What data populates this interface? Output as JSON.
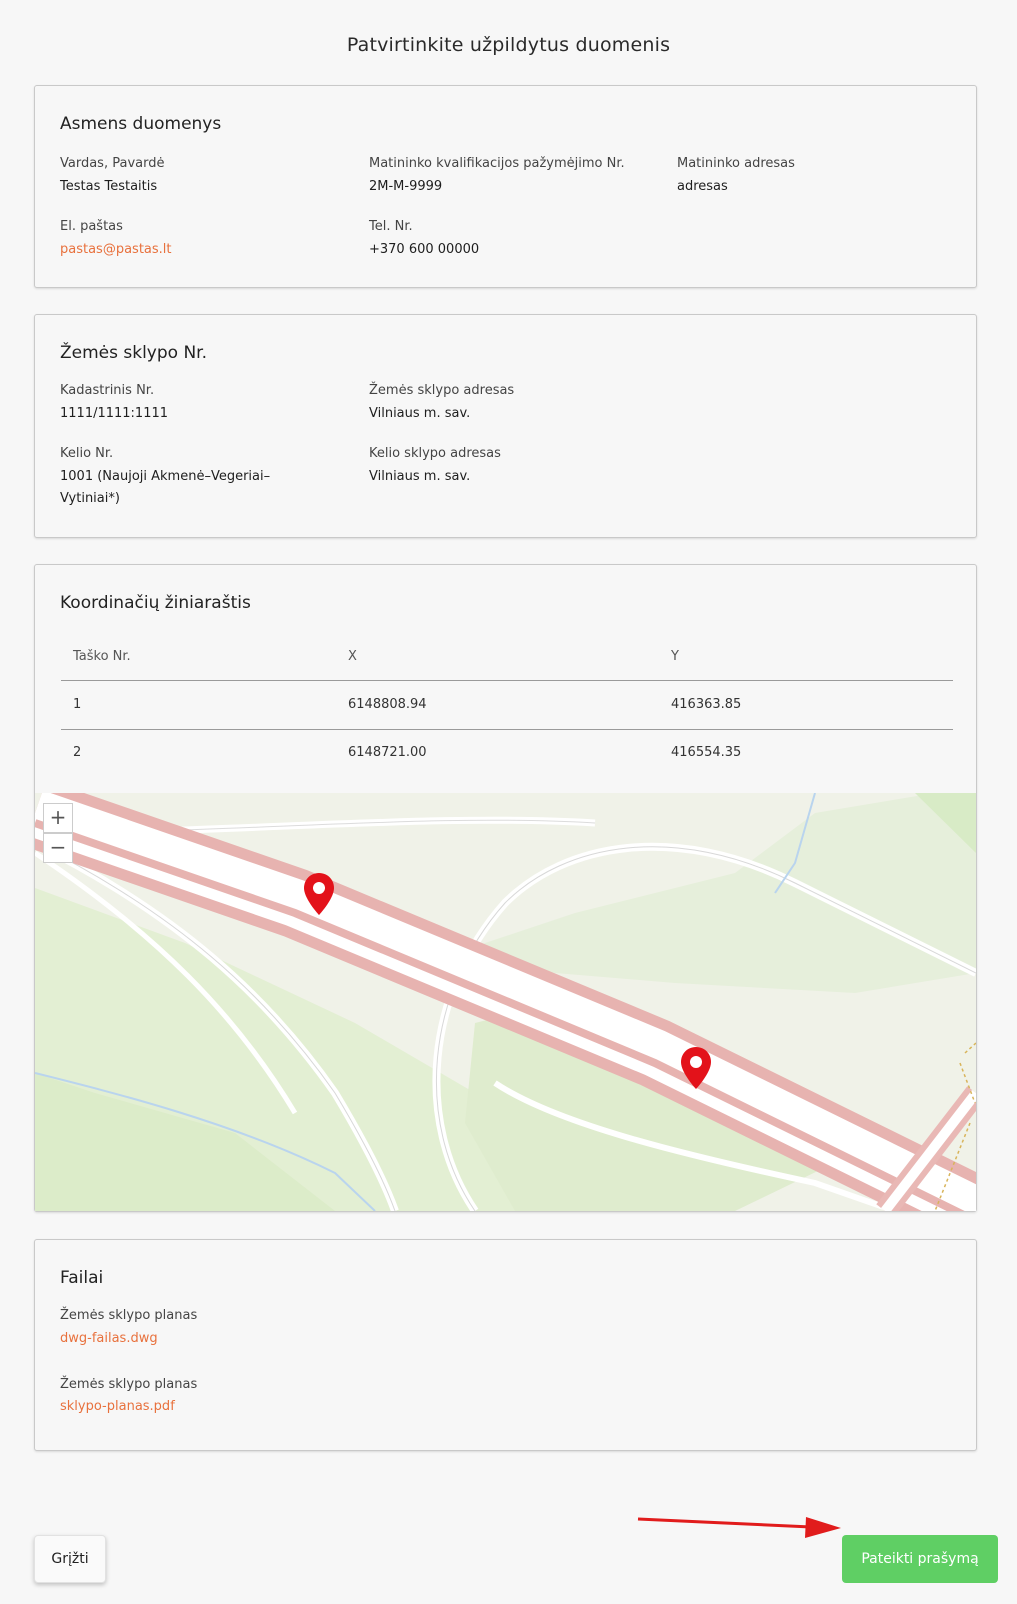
{
  "page_title": "Patvirtinkite užpildytus duomenis",
  "personal": {
    "title": "Asmens duomenys",
    "name_label": "Vardas, Pavardė",
    "name_value": "Testas Testaitis",
    "cert_label": "Matininko kvalifikacijos pažymėjimo Nr.",
    "cert_value": "2M-M-9999",
    "address_label": "Matininko adresas",
    "address_value": "adresas",
    "email_label": "El. paštas",
    "email_value": "pastas@pastas.lt",
    "phone_label": "Tel. Nr.",
    "phone_value": "+370 600 00000"
  },
  "parcel": {
    "title": "Žemės sklypo Nr.",
    "cadastral_label": "Kadastrinis Nr.",
    "cadastral_value": "1111/1111:1111",
    "parcel_address_label": "Žemės sklypo adresas",
    "parcel_address_value": "Vilniaus m. sav.",
    "road_label": "Kelio Nr.",
    "road_value": "1001 (Naujoji Akmenė–Vegeriai–Vytiniai*)",
    "road_address_label": "Kelio sklypo adresas",
    "road_address_value": "Vilniaus m. sav."
  },
  "coordinates": {
    "title": "Koordinačių žiniaraštis",
    "headers": [
      "Taško Nr.",
      "X",
      "Y"
    ],
    "rows": [
      {
        "no": "1",
        "x": "6148808.94",
        "y": "416363.85"
      },
      {
        "no": "2",
        "x": "6148721.00",
        "y": "416554.35"
      }
    ],
    "map_zoom_in": "+",
    "map_zoom_out": "−"
  },
  "files": {
    "title": "Failai",
    "items": [
      {
        "label": "Žemės sklypo planas",
        "file": "dwg-failas.dwg"
      },
      {
        "label": "Žemės sklypo planas",
        "file": "sklypo-planas.pdf"
      }
    ]
  },
  "actions": {
    "back_label": "Grįžti",
    "submit_label": "Pateikti prašymą"
  },
  "colors": {
    "accent_link": "#e8713d",
    "submit_green": "#5fcf64",
    "marker_red": "#e3121a",
    "arrow_red": "#e11c1c"
  }
}
